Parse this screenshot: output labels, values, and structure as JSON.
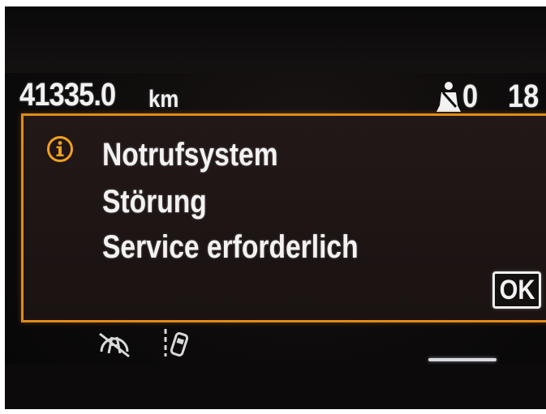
{
  "status_bar": {
    "odometer_value": "41335.0",
    "odometer_unit": "km",
    "seatbelt_count": "0",
    "temperature": "18"
  },
  "message": {
    "title": "Notrufsystem",
    "subtitle": "Störung",
    "action": "Service erforderlich",
    "ok_label": "OK"
  },
  "icons": {
    "message_icon": "info-icon",
    "status_icon": "seatbelt-icon",
    "bottom_icons": [
      "lane-keeping-assist-off-icon",
      "lane-departure-icon"
    ]
  },
  "colors": {
    "frame_accent": "#e08a1a",
    "info_icon": "#f0a020",
    "text": "#f2f2f2"
  }
}
